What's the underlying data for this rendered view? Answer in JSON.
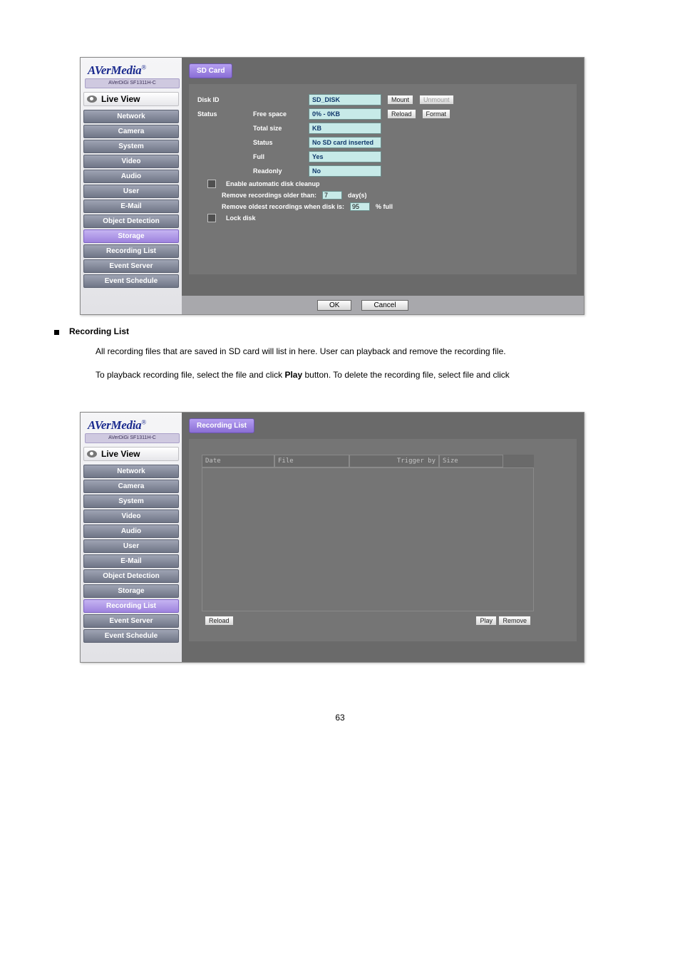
{
  "doc": {
    "sec_title": "Recording List",
    "para1": "All recording files that are saved in SD card will list in here. User can playback and remove the recording file.",
    "para2_part1": "To playback recording file, select the file and click ",
    "para2_play": "Play",
    "para2_part2": " button. To delete the recording file, select file and click",
    "play_btn_label": "Play",
    "page_num": "63"
  },
  "brand": {
    "name": "AVerMedia",
    "model": "AVerDiGi SF1311H-C"
  },
  "liveview": "Live View",
  "nav": [
    "Network",
    "Camera",
    "System",
    "Video",
    "Audio",
    "User",
    "E-Mail",
    "Object Detection",
    "Storage",
    "Recording List",
    "Event Server",
    "Event Schedule"
  ],
  "s1": {
    "tab": "SD Card",
    "diskid_lbl": "Disk ID",
    "diskid_val": "SD_DISK",
    "mount": "Mount",
    "unmount": "Unmount",
    "status_lbl": "Status",
    "free_lbl": "Free space",
    "free_val": "0% - 0KB",
    "reload": "Reload",
    "format": "Format",
    "total_lbl": "Total size",
    "total_val": "KB",
    "st_lbl": "Status",
    "st_val": "No SD card inserted",
    "full_lbl": "Full",
    "full_val": "Yes",
    "ro_lbl": "Readonly",
    "ro_val": "No",
    "cleanup": "Enable automatic disk cleanup",
    "older_a": "Remove recordings older than:",
    "older_val": "7",
    "older_b": "day(s)",
    "full_a": "Remove oldest recordings when disk is:",
    "full_in": "95",
    "full_b": "% full",
    "lockdisk": "Lock disk",
    "ok": "OK",
    "cancel": "Cancel"
  },
  "s2": {
    "tab": "Recording List",
    "h_date": "Date",
    "h_file": "File",
    "h_trig": "Trigger by",
    "h_size": "Size",
    "reload": "Reload",
    "play": "Play",
    "remove": "Remove"
  }
}
